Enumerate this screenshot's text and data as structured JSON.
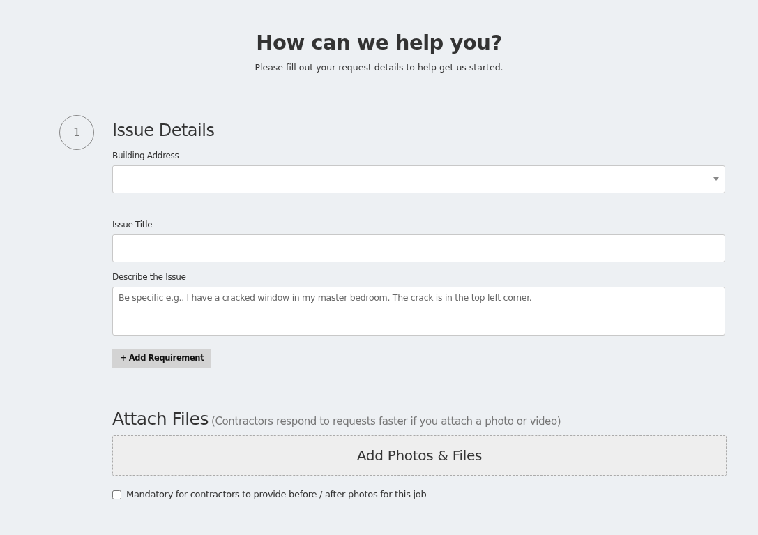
{
  "header": {
    "title": "How can we help you?",
    "subtitle": "Please fill out your request details to help get us started."
  },
  "step": {
    "number": "1",
    "title": "Issue Details"
  },
  "fields": [
    {
      "kind": "select",
      "label": "Building Address"
    },
    {
      "kind": "text",
      "label": "Issue Title"
    },
    {
      "kind": "textarea",
      "label": "Describe the Issue",
      "placeholder": "Be specific e.g.. I have a cracked window in my master bedroom. The crack is in the top left corner."
    }
  ],
  "add_requirement_button": "+ Add Requirement",
  "attach": {
    "title": "Attach Files",
    "hint": "(Contractors respond to requests faster if you attach a photo or video)",
    "dropzone_label": "Add Photos & Files"
  },
  "mandatory_checkbox": {
    "label": "Mandatory for contractors to provide before / after photos for this job",
    "checked": false
  }
}
